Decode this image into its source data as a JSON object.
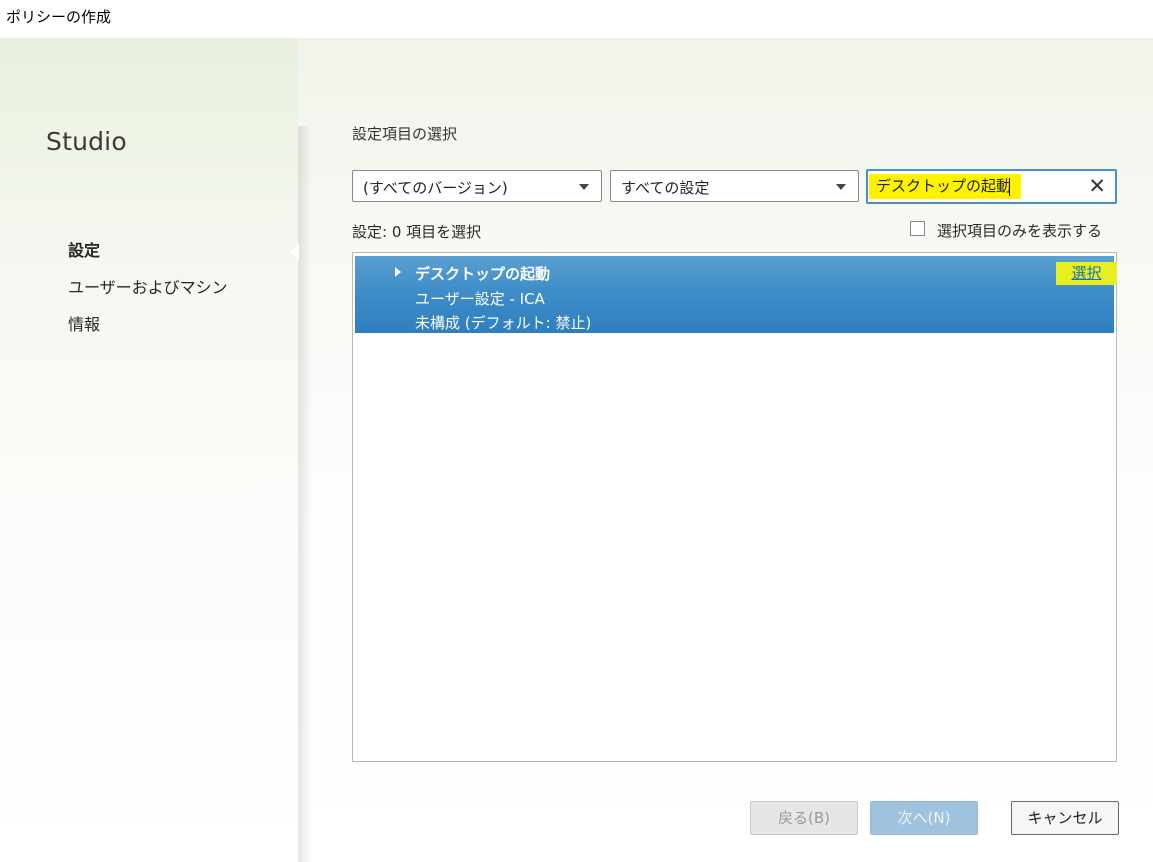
{
  "window": {
    "title": "ポリシーの作成"
  },
  "sidebar": {
    "brand": "Studio",
    "items": [
      {
        "label": "設定",
        "active": true
      },
      {
        "label": "ユーザーおよびマシン",
        "active": false
      },
      {
        "label": "情報",
        "active": false
      }
    ]
  },
  "main": {
    "section_title": "設定項目の選択",
    "version_dropdown": {
      "selected": "(すべてのバージョン)"
    },
    "category_dropdown": {
      "selected": "すべての設定"
    },
    "search": {
      "value": "デスクトップの起動"
    },
    "status": "設定: 0 項目を選択",
    "filter_checkbox": {
      "label": "選択項目のみを表示する",
      "checked": false
    },
    "settings_list": [
      {
        "name": "デスクトップの起動",
        "category": "ユーザー設定 - ICA",
        "state": "未構成 (デフォルト: 禁止)",
        "action": "選択",
        "selected": true
      }
    ]
  },
  "buttons": {
    "back": "戻る(B)",
    "next": "次へ(N)",
    "cancel": "キャンセル"
  },
  "colors": {
    "selection": "#3f8dc8",
    "highlight": "#fff200",
    "accent_link": "#1a6fb8"
  }
}
